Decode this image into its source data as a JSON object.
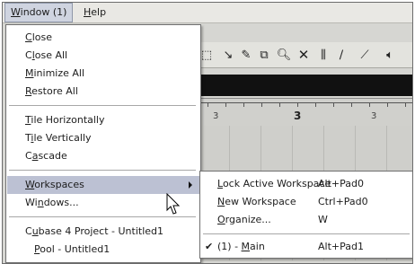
{
  "menubar": {
    "window_label": "Window (1)",
    "help_label": "Help"
  },
  "window_menu": {
    "close": "Close",
    "close_all": "Close All",
    "minimize_all": "Minimize All",
    "restore_all": "Restore All",
    "tile_horizontally": "Tile Horizontally",
    "tile_vertically": "Tile Vertically",
    "cascade": "Cascade",
    "workspaces": "Workspaces",
    "windows": "Windows...",
    "project": "Cubase 4 Project - Untitled1",
    "pool": "Pool - Untitled1"
  },
  "workspaces_submenu": {
    "lock": {
      "label": "Lock Active Workspace",
      "shortcut": "Alt+Pad0"
    },
    "new": {
      "label": "New Workspace",
      "shortcut": "Ctrl+Pad0"
    },
    "organize": {
      "label": "Organize...",
      "shortcut": "W"
    },
    "main": {
      "label": "(1) - Main",
      "shortcut": "Alt+Pad1",
      "check": "✔"
    }
  },
  "ruler": {
    "left": "3",
    "center": "3",
    "right": "3"
  },
  "toolbar_icons": [
    "range-select-icon",
    "object-select-icon",
    "pencil-icon",
    "glue-icon",
    "zoom-icon",
    "erase-icon",
    "split-icon",
    "draw-icon",
    "line-icon",
    "speaker-icon"
  ],
  "colors": {
    "highlight": "#bcc1d3",
    "menubar": "#e9e8e4"
  }
}
